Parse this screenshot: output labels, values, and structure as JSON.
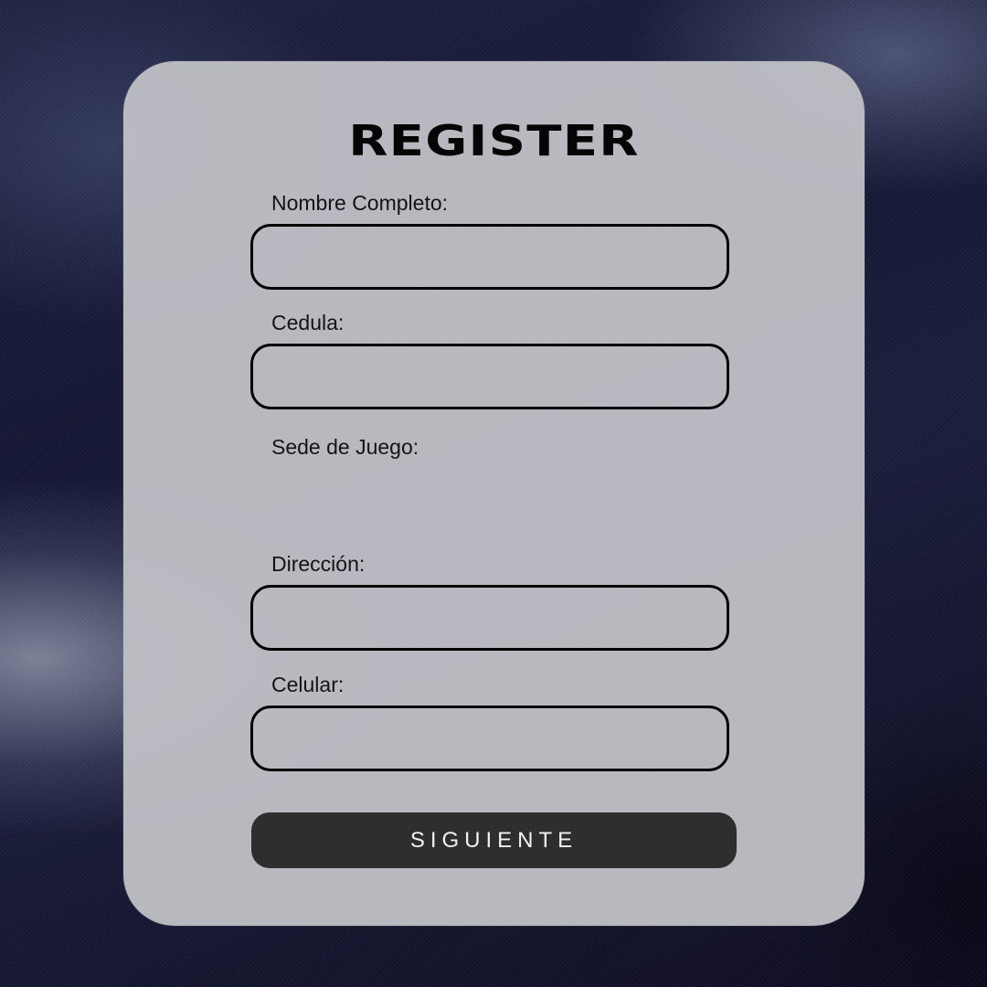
{
  "form": {
    "title": "REGISTER",
    "fields": [
      {
        "label": "Nombre Completo:",
        "value": "",
        "placeholder": ""
      },
      {
        "label": "Cedula:",
        "value": "",
        "placeholder": ""
      },
      {
        "label": "Sede de Juego:"
      },
      {
        "label": "Dirección:",
        "value": "",
        "placeholder": ""
      },
      {
        "label": "Celular:",
        "value": "",
        "placeholder": ""
      }
    ],
    "submit_label": "SIGUIENTE"
  },
  "colors": {
    "card_background": "#bebec4",
    "input_border": "#000000",
    "button_background": "#2e2e2e",
    "button_text": "#f2f2f2"
  }
}
